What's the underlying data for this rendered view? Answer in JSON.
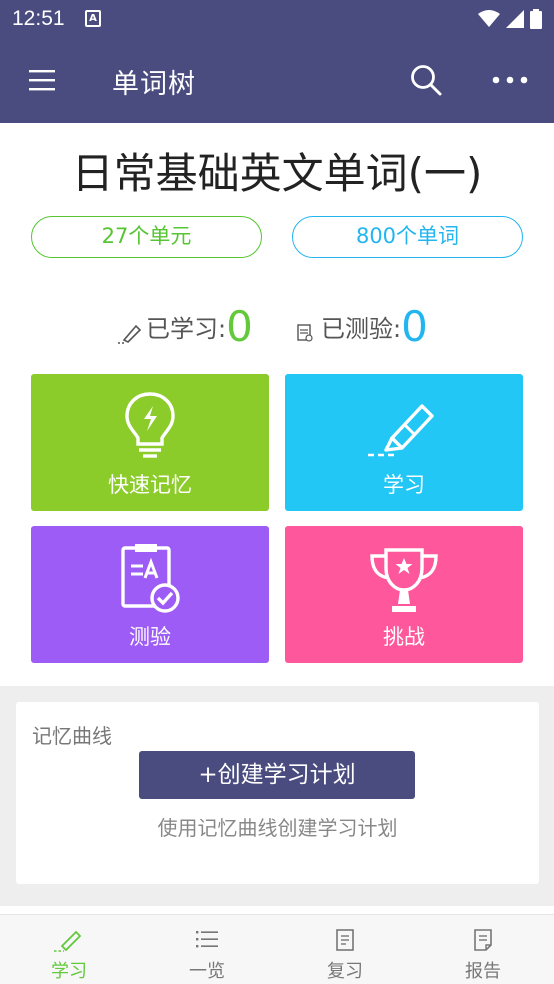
{
  "status": {
    "time": "12:51",
    "a_badge": "A"
  },
  "app_bar": {
    "title": "单词树"
  },
  "book": {
    "title": "日常基础英文单词(一)",
    "units": "27个单元",
    "words": "800个单词"
  },
  "stats": {
    "learned_label": "已学习:",
    "learned_value": "0",
    "tested_label": "已测验:",
    "tested_value": "0"
  },
  "tiles": {
    "memory": "快速记忆",
    "study": "学习",
    "test": "测验",
    "challenge": "挑战"
  },
  "curve": {
    "title": "记忆曲线",
    "create_button": "+创建学习计划",
    "subtitle": "使用记忆曲线创建学习计划"
  },
  "nav": {
    "study": "学习",
    "overview": "一览",
    "review": "复习",
    "report": "报告"
  },
  "colors": {
    "primary": "#4a4c80",
    "green": "#8bcb2a",
    "blue": "#22c7f5",
    "purple": "#9d5cf5",
    "pink": "#ff579c",
    "active": "#62c93a"
  }
}
